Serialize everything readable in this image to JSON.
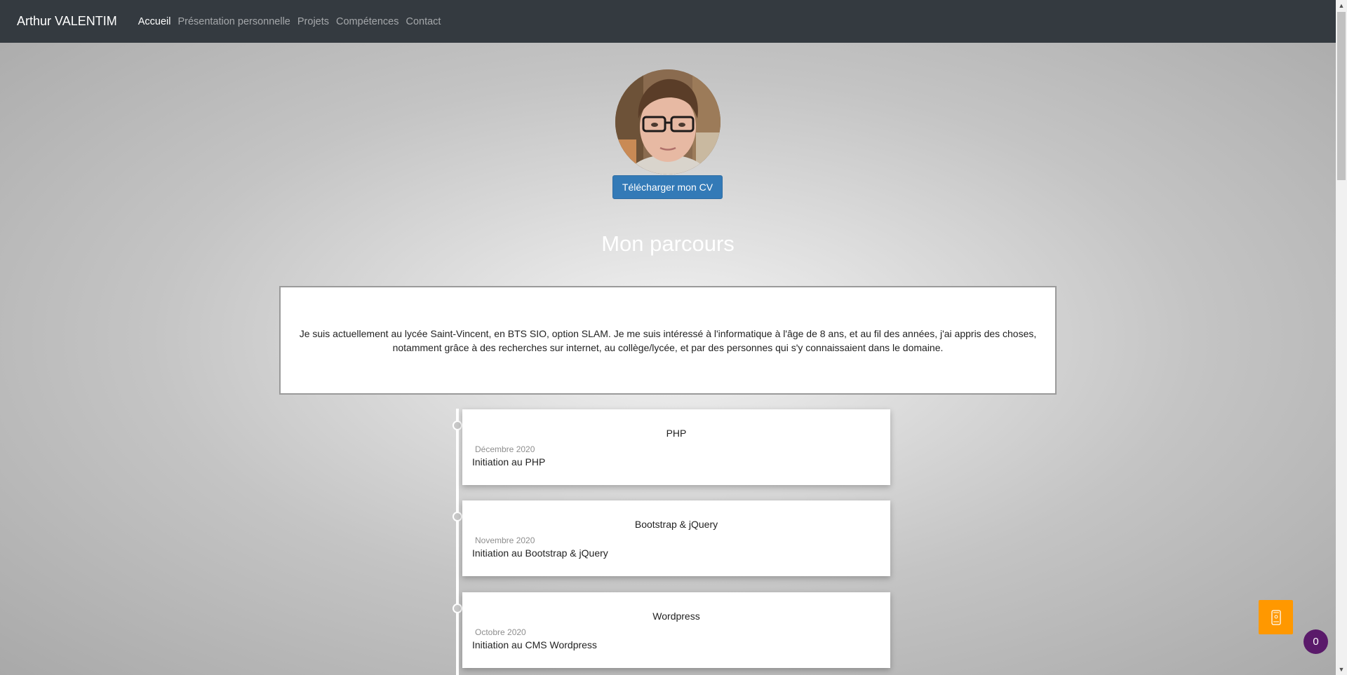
{
  "navbar": {
    "brand": "Arthur VALENTIM",
    "links": [
      {
        "label": "Accueil",
        "active": true
      },
      {
        "label": "Présentation personnelle",
        "active": false
      },
      {
        "label": "Projets",
        "active": false
      },
      {
        "label": "Compétences",
        "active": false
      },
      {
        "label": "Contact",
        "active": false
      }
    ]
  },
  "hero": {
    "cv_button_label": "Télécharger mon CV"
  },
  "parcours": {
    "title": "Mon parcours",
    "intro": "Je suis actuellement au lycée Saint-Vincent, en BTS SIO, option SLAM. Je me suis intéressé à l'informatique à l'âge de 8 ans, et au fil des années, j'ai appris des choses, notamment grâce à des recherches sur internet, au collège/lycée, et par des personnes qui s'y connaissaient dans le domaine."
  },
  "timeline": [
    {
      "title": "PHP",
      "date": "Décembre 2020",
      "description": "Initiation au PHP"
    },
    {
      "title": "Bootstrap & jQuery",
      "date": "Novembre 2020",
      "description": "Initiation au Bootstrap & jQuery"
    },
    {
      "title": "Wordpress",
      "date": "Octobre 2020",
      "description": "Initiation au CMS Wordpress"
    }
  ],
  "widgets": {
    "counter": "0",
    "float_icon": "phone-icon"
  },
  "colors": {
    "navbar_bg": "#343a40",
    "button_primary": "#337ab7",
    "float_button": "#ff9800",
    "badge": "#5a1a6a"
  }
}
